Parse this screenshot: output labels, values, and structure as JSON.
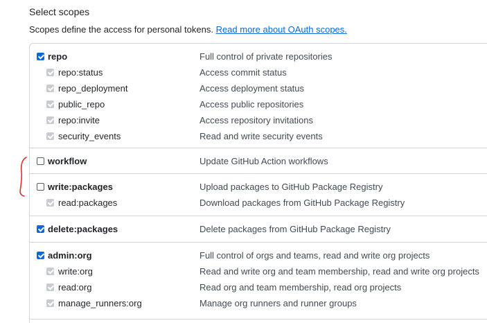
{
  "header": {
    "title": "Select scopes",
    "description": "Scopes define the access for personal tokens.",
    "link_label": "Read more about OAuth scopes."
  },
  "scopes": {
    "repo": {
      "name": "repo",
      "desc": "Full control of private repositories",
      "checked": true,
      "children": [
        {
          "name": "repo:status",
          "desc": "Access commit status"
        },
        {
          "name": "repo_deployment",
          "desc": "Access deployment status"
        },
        {
          "name": "public_repo",
          "desc": "Access public repositories"
        },
        {
          "name": "repo:invite",
          "desc": "Access repository invitations"
        },
        {
          "name": "security_events",
          "desc": "Read and write security events"
        }
      ]
    },
    "workflow": {
      "name": "workflow",
      "desc": "Update GitHub Action workflows",
      "checked": false
    },
    "write_packages": {
      "name": "write:packages",
      "desc": "Upload packages to GitHub Package Registry",
      "checked": false,
      "children": [
        {
          "name": "read:packages",
          "desc": "Download packages from GitHub Package Registry"
        }
      ]
    },
    "delete_packages": {
      "name": "delete:packages",
      "desc": "Delete packages from GitHub Package Registry",
      "checked": true
    },
    "admin_org": {
      "name": "admin:org",
      "desc": "Full control of orgs and teams, read and write org projects",
      "checked": true,
      "children": [
        {
          "name": "write:org",
          "desc": "Read and write org and team membership, read and write org projects"
        },
        {
          "name": "read:org",
          "desc": "Read org and team membership, read org projects"
        },
        {
          "name": "manage_runners:org",
          "desc": "Manage org runners and runner groups"
        }
      ]
    }
  },
  "colors": {
    "accent": "#0969da",
    "annotation": "#e5302f"
  }
}
